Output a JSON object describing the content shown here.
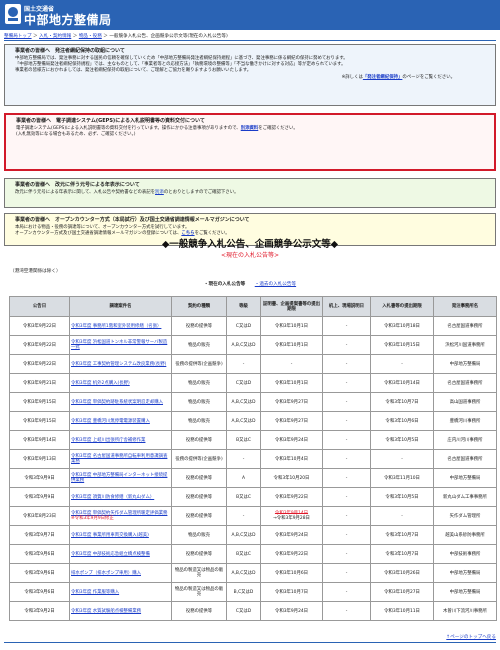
{
  "header": {
    "subtitle": "国土交通省",
    "title": "中部地方整備局",
    "brand_color": "#2a63b4"
  },
  "breadcrumb": [
    "整備局トップ",
    "入札・契約情報",
    "物品・役務",
    "一般競争入札公告、企画競争公示文等(現在の入札公告等)"
  ],
  "notices": [
    {
      "title": "事業者の皆様へ　発注者綱紀保持の取組について",
      "lines": [
        "中部地方整備局では、発注事務に対する国民の信頼を確保していくため「中部地方整備局発注者綱紀保持規程」に基づき、発注事務に係る綱紀の保持に努めております。",
        "「中部地方整備局発注者綱紀保持規程」では、主なものとして、「事業者等との応接方法」「執務環境の整備等」「不当な働きかけに対する対応」等が定められています。",
        "事業者の皆様方におかれましては、発注者綱紀保持の取組について、ご理解とご協力を賜りますようお願いいたします。"
      ],
      "foot_prefix": "※詳しくは",
      "foot_link": "「発注者綱紀保持」",
      "foot_suffix": "のページをご覧ください。"
    },
    {
      "title": "事業者の皆様へ　電子調達システム(GEPS)による入札説明書等の資料交付について",
      "line1": "電子調達システム(GEPS)による入札説明書等の資料交付を行っています。操作にかかる注意事項がありますので、",
      "link": "別添資料",
      "line1_suffix": "をご確認ください。",
      "line2": "(入札無効等になる場合もあるため、必ず、ご確認ください。)"
    },
    {
      "title": "事業者の皆様へ　改元に伴う元号による年表示について",
      "line1": "改元に伴う元号による年表示に関して、入札公告や契約書などの表記を",
      "link": "別添",
      "line1_suffix": "のとおりとしますのでご確認下さい。"
    },
    {
      "title": "事業者の皆様へ　オープンカウンター方式（本局試行）及び国土交通省調達情報メールマガジンについて",
      "line1": "本局における物品・役務の調達等について、オープンカウンター方式を試行しています。",
      "line2": "オープンカウンター方式及び国土交通省調達情報メールマガジンの登録については、",
      "link": "こちら",
      "line2_suffix": "をご覧ください。"
    }
  ],
  "heading": "◆一般競争入札公告、企画競争公示文等◆",
  "subheading": "<現在の入札公告等>",
  "exclude_note": "（港湾空港関係は除く）",
  "tabs": {
    "current": "・現在の入札公告等",
    "past": "・過去の入札公告等"
  },
  "table": {
    "headers": [
      "公告日",
      "調達案件名",
      "契約の種類",
      "等級",
      "証明書、企画提案書等の提出期限",
      "机上、現場説明日",
      "入札書等の提出期限",
      "発注事務所名"
    ],
    "rows": [
      {
        "date": "令和3年9月22日",
        "name": "令和3年度 事務所1階和室外装用修繕（名張）",
        "type": "役務の提供等",
        "grade": "C又はD",
        "deadline": "令和3年10月1日",
        "briefing": "-",
        "bid": "令和3年10月18日",
        "office": "名古屋国道事務所"
      },
      {
        "date": "令和3年9月22日",
        "name": "令和3年度 浜松国道トンネル非常警報サーバ製造一式",
        "type": "物品の販売",
        "grade": "A,B,C又はD",
        "deadline": "令和3年10月1日",
        "briefing": "-",
        "bid": "令和3年10月15日",
        "office": "浜松河川国道事務所"
      },
      {
        "date": "令和3年9月22日",
        "name": "令和3年度 工事契約管理システム改良業務(長野)",
        "type": "役務の提供等(企画競争)",
        "grade": "-",
        "deadline": "-",
        "briefing": "-",
        "bid": "-",
        "office": "中部地方整備局"
      },
      {
        "date": "令和3年9月21日",
        "name": "令和3年度 机外2点購入(長野)",
        "type": "物品の販売",
        "grade": "C又はD",
        "deadline": "令和3年10月1日",
        "briefing": "-",
        "bid": "令和3年10月14日",
        "office": "名古屋国道事務所"
      },
      {
        "date": "令和3年9月15日",
        "name": "令和3年度 単価契約跡駐系統状案明忍走却購入",
        "type": "物品の販売",
        "grade": "A,B,C又はD",
        "deadline": "令和3年9月27日",
        "briefing": "-",
        "bid": "令和3年10月7日",
        "office": "高山国道事務所"
      },
      {
        "date": "令和3年9月15日",
        "name": "令和3年度 豊橋河川無停電電源装置購入",
        "type": "物品の販売",
        "grade": "A,B,C又はD",
        "deadline": "令和3年9月27日",
        "briefing": "-",
        "bid": "令和3年10月6日",
        "office": "豊橋河川事務所"
      },
      {
        "date": "令和3年9月14日",
        "name": "令和3年度 上岐川出張所庁舎補修作業",
        "type": "役務の提供等",
        "grade": "B又はC",
        "deadline": "令和3年9月24日",
        "briefing": "-",
        "bid": "令和3年10月5日",
        "office": "庄内川河川事務所"
      },
      {
        "date": "令和3年9月13日",
        "name": "令和3年度 名古屋国道事務所自転車利用意識調査業務",
        "type": "役務の提供等(企画競争)",
        "grade": "-",
        "deadline": "令和3年10月4日",
        "briefing": "-",
        "bid": "-",
        "office": "名古屋国道事務所"
      },
      {
        "date": "令和3年9月9日",
        "name": "令和3年度 中部地方整備局インターネット接続提供業務",
        "type": "役務の提供等",
        "grade": "A",
        "deadline": "令和3年10月20日",
        "briefing": "-",
        "bid": "令和3年11月10日",
        "office": "中部地方整備局"
      },
      {
        "date": "令和3年9月9日",
        "name": "令和3年度 須賀川防食修繕（新丸山ダム）",
        "type": "役務の提供等",
        "grade": "B又はC",
        "deadline": "令和3年9月22日",
        "briefing": "-",
        "bid": "令和3年10月5日",
        "office": "新丸山ダム工事事務所"
      },
      {
        "date": "令和3年8月23日",
        "name": "令和3年度 単価契約矢作ダム管理所暖定評価業務",
        "amend": "※令和3年9月9日修正",
        "type": "役務の提供等",
        "grade": "-",
        "deadline_struck": "令和3年9月14日",
        "deadline": "→令和3年9月28日",
        "briefing": "-",
        "bid": "-",
        "office": "矢作ダム管理所"
      },
      {
        "date": "令和3年9月7日",
        "name": "令和3年度 事業所用車両交換購入(越美)",
        "type": "物品の販売",
        "grade": "A,B,C又はD",
        "deadline": "令和3年9月24日",
        "briefing": "-",
        "bid": "令和3年10月7日",
        "office": "越美山系砂防事務所"
      },
      {
        "date": "令和3年9月6日",
        "name": "令和3年度 中部技術応急組立橋点検整備",
        "type": "役務の提供等",
        "grade": "B又はC",
        "deadline": "令和3年9月22日",
        "briefing": "-",
        "bid": "令和3年10月7日",
        "office": "中部技術事務所"
      },
      {
        "date": "令和3年9月6日",
        "name": "排水ポンプ（排水ポンプ車用）購入",
        "type": "物品の製造又は物品の販売",
        "grade": "A,B,C又はD",
        "deadline": "令和3年10月6日",
        "briefing": "-",
        "bid": "令和3年10月26日",
        "office": "中部地方整備局"
      },
      {
        "date": "令和3年9月6日",
        "name": "令和3年度 作業服等購入",
        "type": "物品の製造又は物品の販売",
        "grade": "B,C又はD",
        "deadline": "令和3年10月7日",
        "briefing": "-",
        "bid": "令和3年10月27日",
        "office": "中部地方整備局"
      },
      {
        "date": "令和3年9月2日",
        "name": "令和3年度 水質試験船点検整備業務",
        "type": "役務の提供等",
        "grade": "C又はD",
        "deadline": "令和3年9月24日",
        "briefing": "-",
        "bid": "令和3年10月11日",
        "office": "木曽川下流河川事務所"
      }
    ]
  },
  "page_top": "↑ページのトップへ戻る"
}
